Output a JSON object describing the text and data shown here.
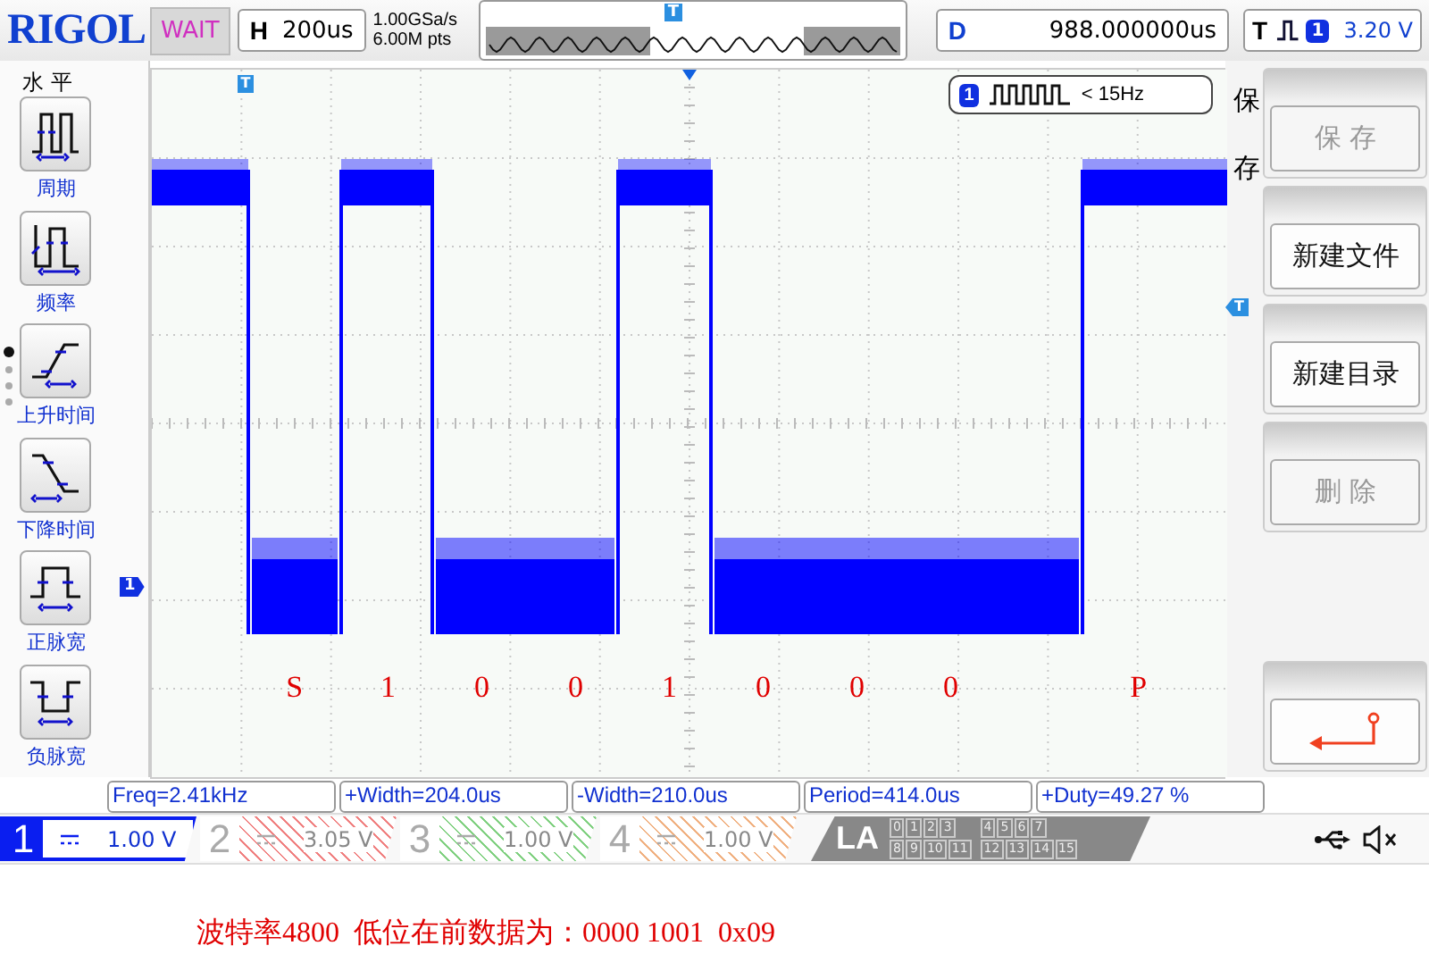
{
  "top_bar": {
    "logo": "RIGOL",
    "run_status": "WAIT",
    "timebase": {
      "label": "H",
      "value": "200us"
    },
    "sample_rate": "1.00GSa/s",
    "memory_depth": "6.00M pts",
    "trigger_position_marker": "T",
    "delay": {
      "label": "D",
      "value": "988.000000us"
    },
    "trigger": {
      "label": "T",
      "source": "1",
      "level": "3.20 V"
    }
  },
  "left_menu": {
    "title": "水 平",
    "pages": [
      {
        "selected": true
      },
      {
        "selected": false
      },
      {
        "selected": false
      },
      {
        "selected": false
      }
    ],
    "items": [
      {
        "kind": "period",
        "label": "周期"
      },
      {
        "kind": "frequency",
        "label": "频率"
      },
      {
        "kind": "rise",
        "label": "上升时间"
      },
      {
        "kind": "fall",
        "label": "下降时间"
      },
      {
        "kind": "pos_width",
        "label": "正脉宽"
      },
      {
        "kind": "neg_width",
        "label": "负脉宽"
      }
    ]
  },
  "plot": {
    "trigger_marker": "T",
    "channel_marker": "1",
    "trigger_level_marker": "T",
    "counter": {
      "source": "1",
      "reading": "< 15Hz"
    },
    "bit_labels": [
      "S",
      "1",
      "0",
      "0",
      "1",
      "0",
      "0",
      "0",
      "P"
    ]
  },
  "right_menu": {
    "title": "保存",
    "buttons": [
      {
        "kind": "text",
        "label": "保 存",
        "disabled": true
      },
      {
        "kind": "text",
        "label": "新建文件",
        "disabled": false
      },
      {
        "kind": "text",
        "label": "新建目录",
        "disabled": false
      },
      {
        "kind": "text",
        "label": "删 除",
        "disabled": true
      },
      {
        "kind": "back",
        "disabled": false
      }
    ]
  },
  "measurements": [
    "Freq=2.41kHz",
    "+Width=204.0us",
    "-Width=210.0us",
    "Period=414.0us",
    "+Duty=49.27 %"
  ],
  "channels": [
    {
      "number": "1",
      "scale": "1.00 V",
      "selected": true,
      "color": "#0a1ef0"
    },
    {
      "number": "2",
      "scale": "3.05 V",
      "selected": false,
      "color": "#f08080"
    },
    {
      "number": "3",
      "scale": "1.00 V",
      "selected": false,
      "color": "#80d080"
    },
    {
      "number": "4",
      "scale": "1.00 V",
      "selected": false,
      "color": "#f0b080"
    }
  ],
  "logic_analyzer": {
    "label": "LA",
    "groups": [
      [
        "0",
        "1",
        "2",
        "3"
      ],
      [
        "4",
        "5",
        "6",
        "7"
      ],
      [
        "8",
        "9",
        "10",
        "11"
      ],
      [
        "12",
        "13",
        "14",
        "15"
      ]
    ]
  },
  "caption": "波特率4800  低位在前数据为：0000 1001  0x09"
}
